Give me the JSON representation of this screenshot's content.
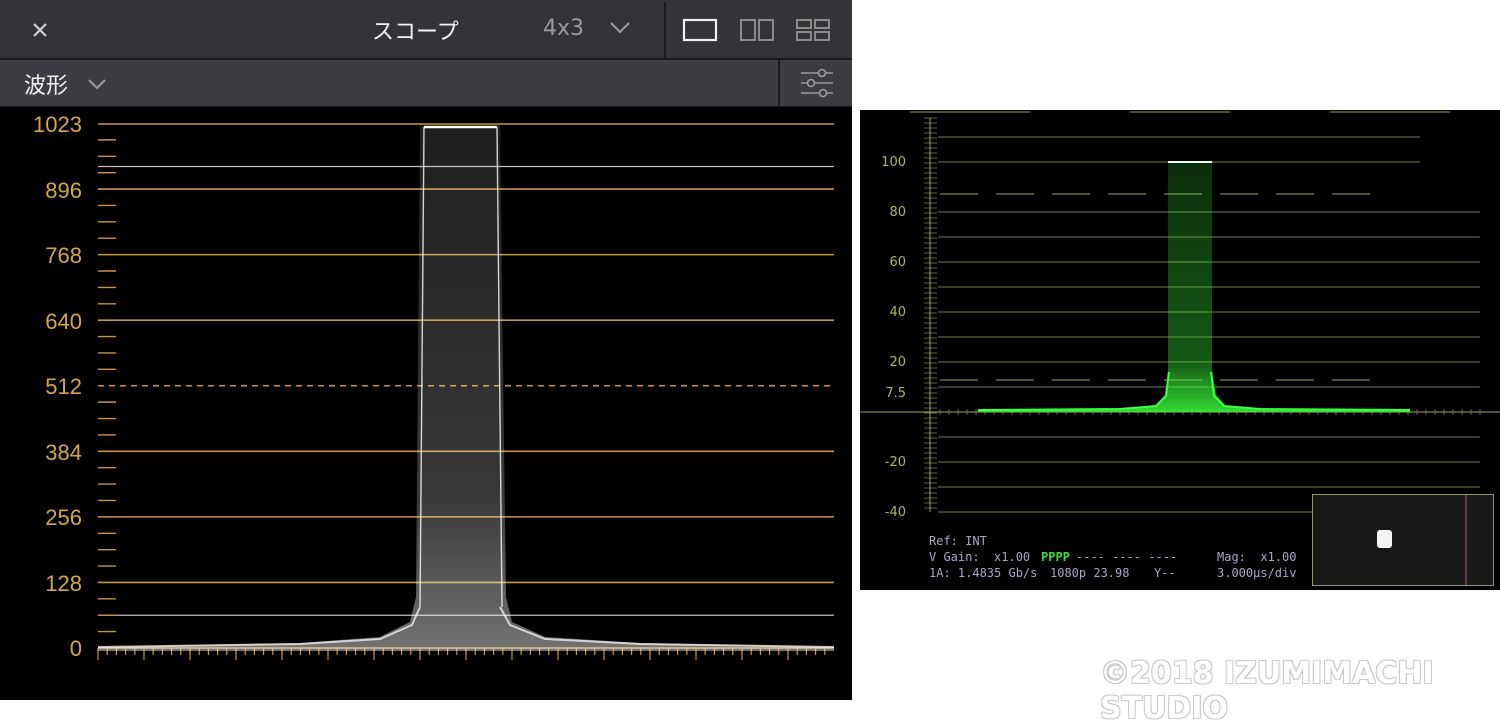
{
  "left_panel": {
    "close_icon": "close-icon",
    "title": "スコープ",
    "grid_mode": "4x3",
    "layout_buttons": [
      "single-view-icon",
      "dual-view-icon",
      "quad-view-icon"
    ],
    "scope_type": "波形",
    "settings_icon": "sliders-icon",
    "y_axis_labels": [
      "1023",
      "896",
      "768",
      "640",
      "512",
      "384",
      "256",
      "128",
      "0"
    ],
    "grid_color": "#c8963c",
    "trace_color": "#ffffff"
  },
  "right_panel": {
    "scale_labels": [
      "100",
      "80",
      "60",
      "40",
      "20",
      "7.5",
      "-20",
      "-40"
    ],
    "ref": "Ref: INT",
    "v_gain": "V Gain:  x1.00",
    "pppp": "PPPP",
    "dashes": "---- ---- ----",
    "mag": "Mag:  x1.00",
    "link": "1A: 1.4835 Gb/s",
    "format": "1080p 23.98",
    "y_mode": "Y--",
    "timebase": "3.000μs/div",
    "grid_color": "#9aa85a",
    "trace_color": "#3cff3c"
  },
  "watermark": "©2018 IZUMIMACHI STUDIO"
}
